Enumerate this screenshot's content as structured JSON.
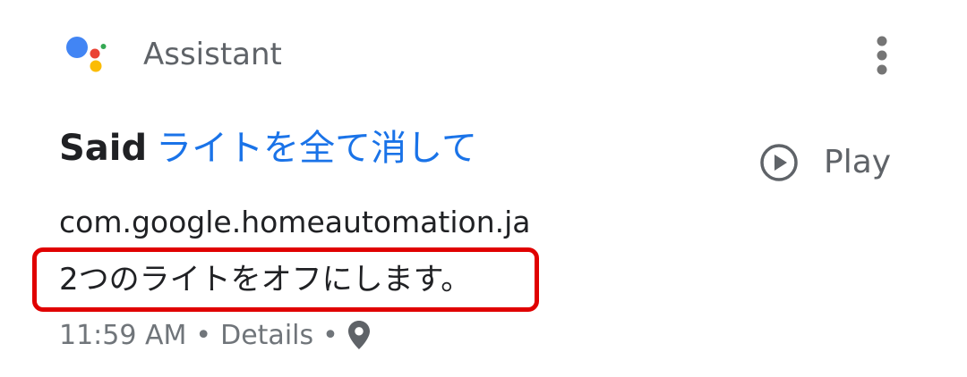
{
  "header": {
    "app_name": "Assistant",
    "logo_icon": "google-assistant-logo",
    "menu_icon": "more-vert-icon"
  },
  "activity": {
    "said_prefix": "Said",
    "query": "ライトを全て消して",
    "play_label": "Play",
    "play_icon": "play-circle-icon",
    "package": "com.google.homeautomation.ja",
    "response": "2つのライトをオフにします。",
    "time": "11:59 AM",
    "separator": "•",
    "details_label": "Details",
    "location_icon": "location-pin-icon"
  },
  "colors": {
    "query_blue": "#1a73e8",
    "highlight_red": "#e00000",
    "secondary_text": "#5f6368",
    "logo_blue": "#4285f4",
    "logo_red": "#ea4335",
    "logo_yellow": "#fbbc04",
    "logo_green": "#34a853"
  }
}
